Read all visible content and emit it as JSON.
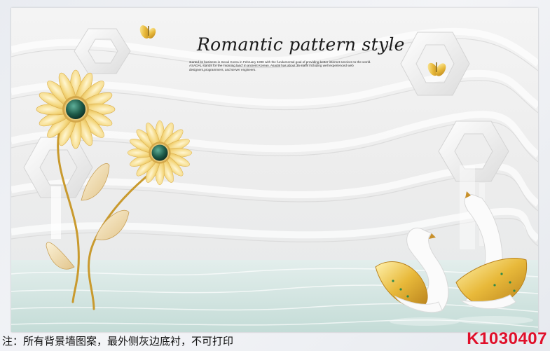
{
  "artwork": {
    "title": "Romantic pattern style",
    "blurb": "started its business in Seoul Korea in February 1998 with the fundamental goal of providing better internet services to the world. ASADAL stands for the 'morning land' in ancient Korean. Asadal has about 35 staffs including well experienced web designers,programmers, and server engineers."
  },
  "footer": {
    "note": "注：所有背景墙图案，最外侧灰边底衬，不可打印",
    "code": "K1030407"
  },
  "colors": {
    "petal": "#f2cf6a",
    "gem": "#1f5c4a",
    "water": "#cfe3de",
    "code": "#e0102a"
  },
  "icons": [
    "flower-icon",
    "swan-icon",
    "butterfly-icon",
    "hexagon-frame-icon"
  ]
}
